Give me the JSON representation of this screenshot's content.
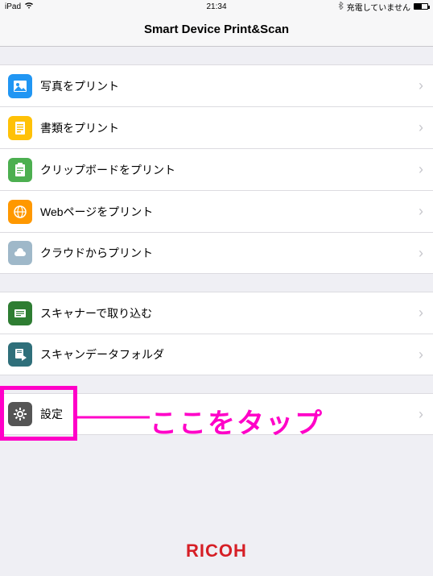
{
  "status": {
    "device": "iPad",
    "time": "21:34",
    "charge_text": "充電していません"
  },
  "header": {
    "title": "Smart Device Print&Scan"
  },
  "groups": [
    {
      "items": [
        {
          "id": "photo",
          "label": "写真をプリント",
          "icon": "photo-icon"
        },
        {
          "id": "doc",
          "label": "書類をプリント",
          "icon": "document-icon"
        },
        {
          "id": "clip",
          "label": "クリップボードをプリント",
          "icon": "clipboard-icon"
        },
        {
          "id": "web",
          "label": "Webページをプリント",
          "icon": "web-icon"
        },
        {
          "id": "cloud",
          "label": "クラウドからプリント",
          "icon": "cloud-icon"
        }
      ]
    },
    {
      "items": [
        {
          "id": "scanner",
          "label": "スキャナーで取り込む",
          "icon": "scanner-icon"
        },
        {
          "id": "folder",
          "label": "スキャンデータフォルダ",
          "icon": "scan-folder-icon"
        }
      ]
    },
    {
      "items": [
        {
          "id": "settings",
          "label": "設定",
          "icon": "gear-icon"
        }
      ]
    }
  ],
  "annotation": {
    "text": "ここをタップ"
  },
  "brand": "RICOH"
}
